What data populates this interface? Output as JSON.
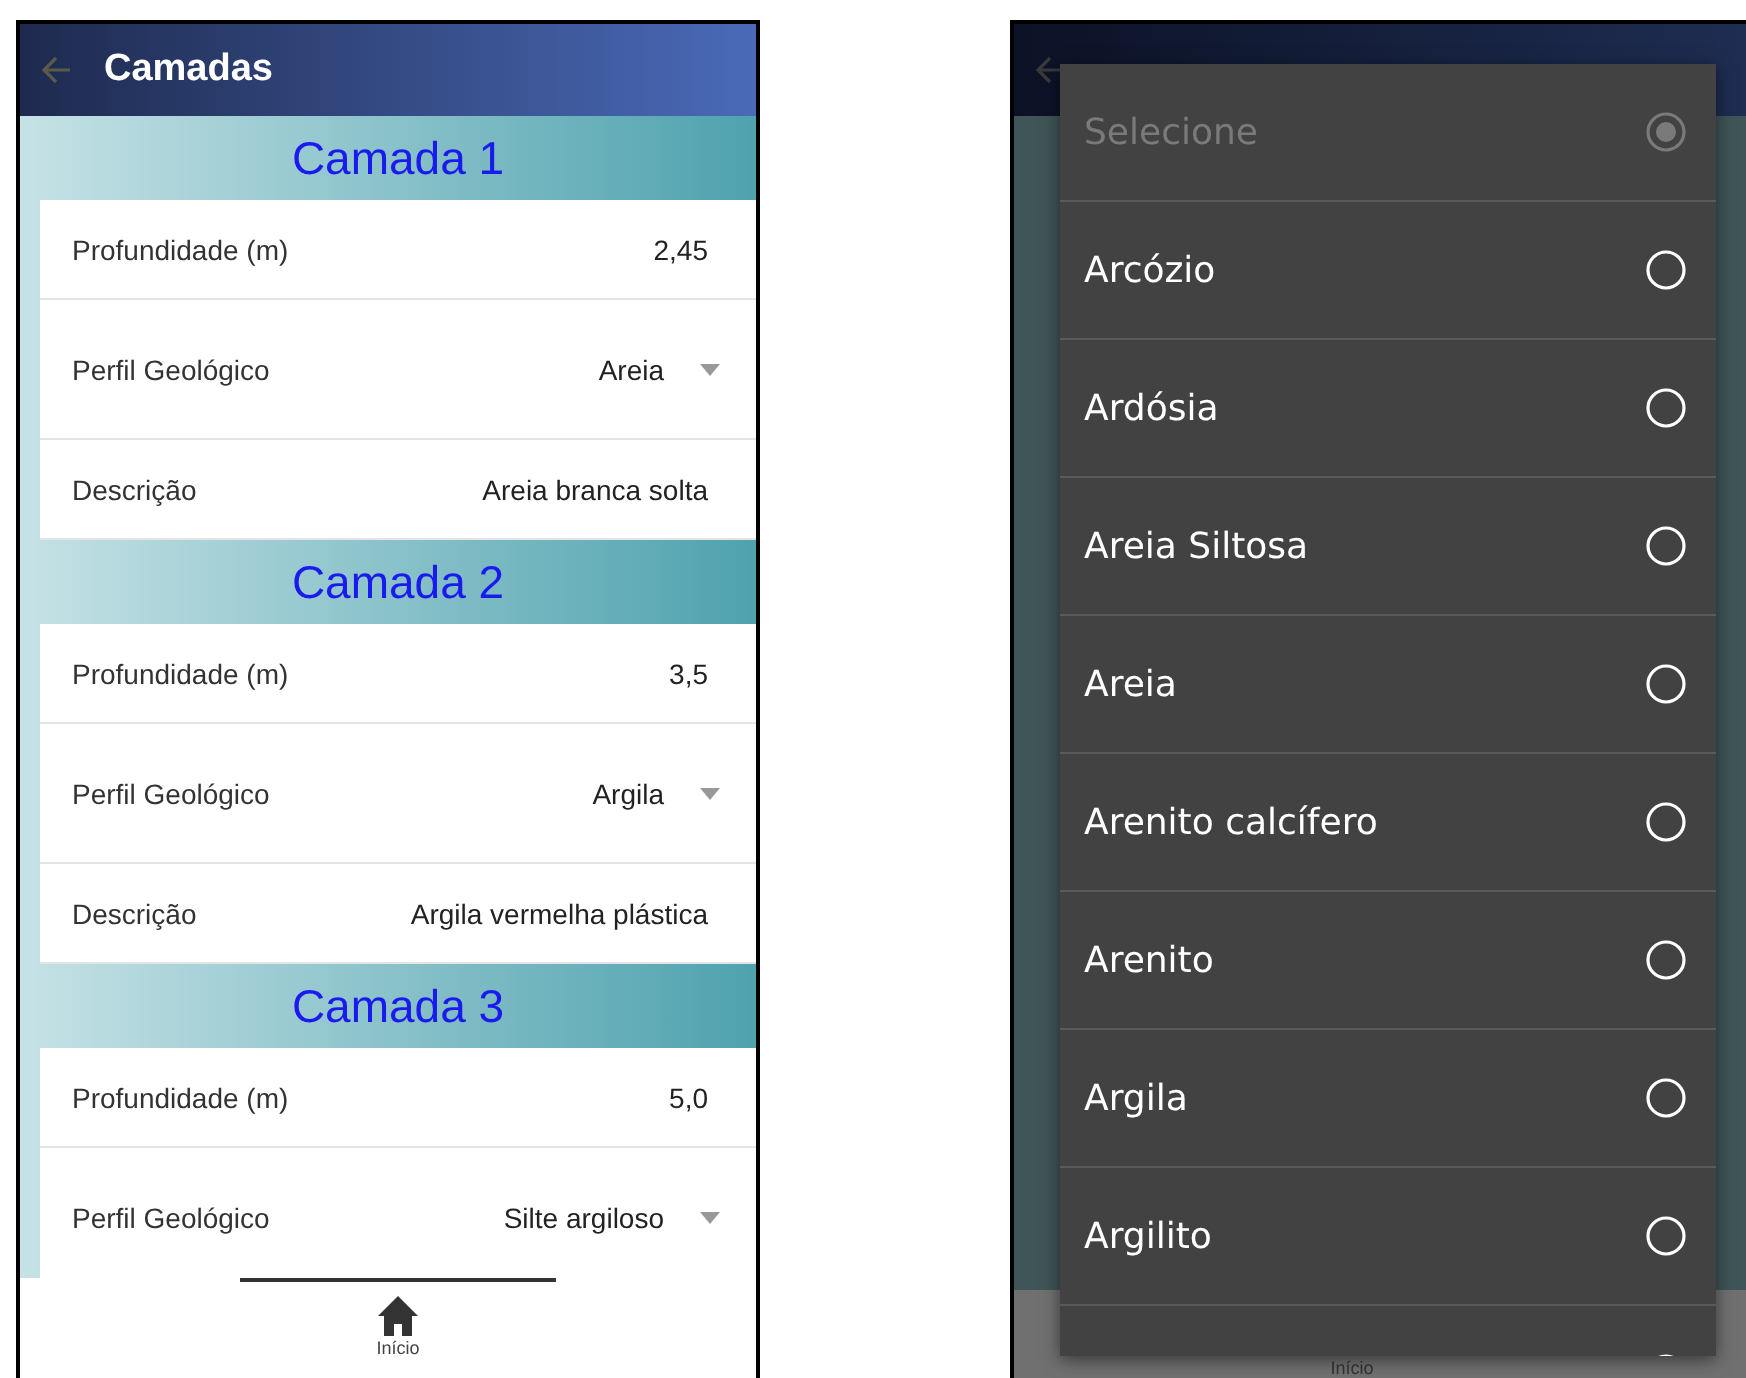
{
  "form_screen": {
    "title": "Camadas",
    "layers": [
      {
        "title": "Camada 1",
        "fields": [
          {
            "kind": "text",
            "label": "Profundidade (m)",
            "value": "2,45"
          },
          {
            "kind": "select",
            "label": "Perfil Geológico",
            "value": "Areia"
          },
          {
            "kind": "text",
            "label": "Descrição",
            "value": "Areia branca solta"
          }
        ]
      },
      {
        "title": "Camada 2",
        "fields": [
          {
            "kind": "text",
            "label": "Profundidade (m)",
            "value": "3,5"
          },
          {
            "kind": "select",
            "label": "Perfil Geológico",
            "value": "Argila"
          },
          {
            "kind": "text",
            "label": "Descrição",
            "value": "Argila vermelha plástica"
          }
        ]
      },
      {
        "title": "Camada 3",
        "fields": [
          {
            "kind": "text",
            "label": "Profundidade (m)",
            "value": "5,0"
          },
          {
            "kind": "select",
            "label": "Perfil Geológico",
            "value": "Silte argiloso"
          }
        ]
      }
    ],
    "nav": {
      "label": "Início"
    }
  },
  "picker_screen": {
    "nav": {
      "label": "Início"
    },
    "options": [
      {
        "label": "Selecione",
        "selected": true,
        "disabled": true
      },
      {
        "label": "Arcózio",
        "selected": false,
        "disabled": false
      },
      {
        "label": "Ardósia",
        "selected": false,
        "disabled": false
      },
      {
        "label": "Areia Siltosa",
        "selected": false,
        "disabled": false
      },
      {
        "label": "Areia",
        "selected": false,
        "disabled": false
      },
      {
        "label": "Arenito calcífero",
        "selected": false,
        "disabled": false
      },
      {
        "label": "Arenito",
        "selected": false,
        "disabled": false
      },
      {
        "label": "Argila",
        "selected": false,
        "disabled": false
      },
      {
        "label": "Argilito",
        "selected": false,
        "disabled": false
      }
    ]
  }
}
